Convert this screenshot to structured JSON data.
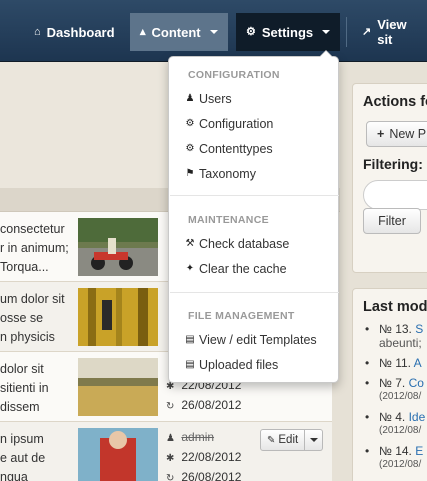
{
  "nav": {
    "dashboard": "Dashboard",
    "content": "Content",
    "settings": "Settings",
    "viewsite": "View sit"
  },
  "dropdown": {
    "configuration_header": "CONFIGURATION",
    "users": "Users",
    "configuration": "Configuration",
    "contenttypes": "Contenttypes",
    "taxonomy": "Taxonomy",
    "maintenance_header": "MAINTENANCE",
    "check_database": "Check database",
    "clear_cache": "Clear the cache",
    "file_management_header": "FILE MANAGEMENT",
    "view_templates": "View / edit Templates",
    "uploaded_files": "Uploaded files"
  },
  "rows": [
    {
      "lines": [
        "consectetur",
        "r in animum;",
        "Torqua..."
      ]
    },
    {
      "lines": [
        "um dolor sit",
        "osse se",
        "n physicis"
      ]
    },
    {
      "lines": [
        "dolor sit",
        "sitienti in",
        "dissem"
      ],
      "created": "22/08/2012",
      "modified": "26/08/2012"
    },
    {
      "lines": [
        "n ipsum",
        "e aut de",
        "ngua"
      ],
      "author": "admin",
      "created": "22/08/2012",
      "modified": "26/08/2012",
      "edit_label": "Edit"
    }
  ],
  "actions": {
    "title": "Actions fo",
    "new_label": "New P",
    "filtering_label": "Filtering:",
    "filter_button": "Filter"
  },
  "lastmod": {
    "title": "Last mod",
    "items": [
      {
        "num": "№ 13.",
        "title": "S",
        "sub": "abeunti;"
      },
      {
        "num": "№ 11.",
        "title": "A"
      },
      {
        "num": "№ 7.",
        "title": "Co",
        "date": "(2012/08/"
      },
      {
        "num": "№ 4.",
        "title": "Ide",
        "date": "(2012/08/"
      },
      {
        "num": "№ 14.",
        "title": "E",
        "date": "(2012/08/"
      }
    ]
  }
}
